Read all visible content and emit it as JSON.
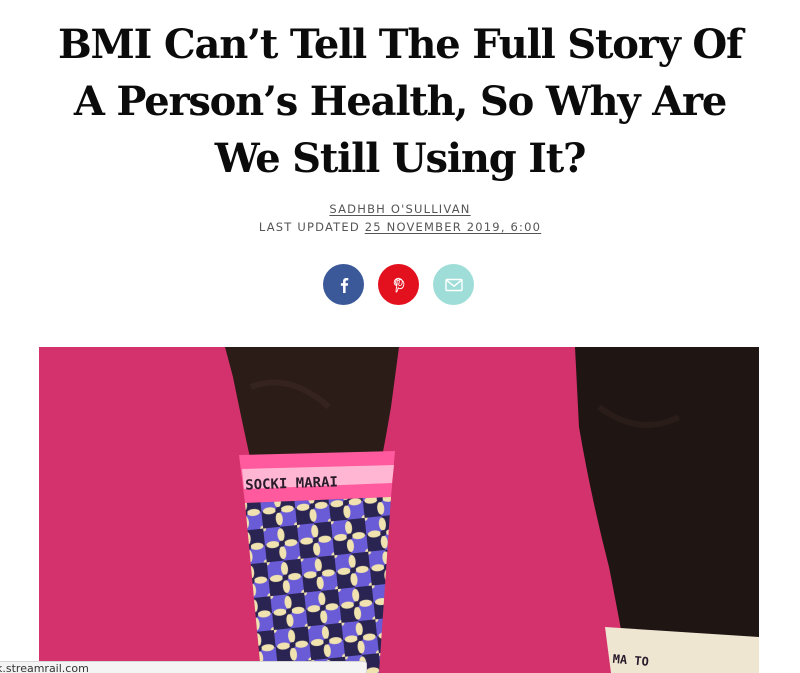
{
  "article": {
    "headline_lines": [
      "BMI Can’t Tell The Full Story Of",
      "A Person’s Health, So Why Are",
      "We Still Using It?"
    ],
    "author": "SADHBH O'SULLIVAN",
    "updated_label": "LAST UPDATED",
    "updated_date": "25 NOVEMBER 2019, 6:00"
  },
  "share": {
    "buttons": [
      {
        "network": "facebook",
        "icon": "facebook-icon",
        "color": "#3b5998"
      },
      {
        "network": "pinterest",
        "icon": "pinterest-icon",
        "color": "#e3101d"
      },
      {
        "network": "email",
        "icon": "mail-icon",
        "color": "#9fddd8"
      }
    ]
  },
  "hero_image": {
    "background_color": "#d9356f",
    "sock_band_text": "SOCKI MARAI",
    "sock_band_color": "#ff5a9e",
    "right_sock_text": "MA TO"
  },
  "status_bar": {
    "url": "k.streamrail.com"
  }
}
